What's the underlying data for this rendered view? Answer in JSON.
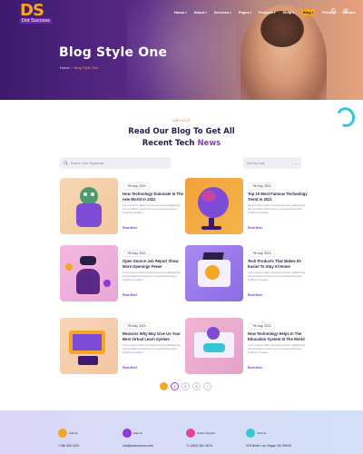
{
  "header": {
    "logo_mark": "DS",
    "logo_sub": "Dot Success",
    "nav": [
      {
        "label": "Home",
        "caret": true
      },
      {
        "label": "About",
        "caret": true
      },
      {
        "label": "Services",
        "caret": true
      },
      {
        "label": "Pages",
        "caret": true
      },
      {
        "label": "Projects",
        "caret": true
      },
      {
        "label": "Shop",
        "caret": true
      },
      {
        "label": "Blog",
        "caret": true,
        "active": true
      },
      {
        "label": "Pricing",
        "caret": false
      },
      {
        "label": "Contact",
        "caret": false
      }
    ],
    "icons": [
      "search-icon",
      "menu-icon"
    ]
  },
  "hero": {
    "title": "Blog Style One",
    "breadcrumb": {
      "home": "Home",
      "sep": "/",
      "current": "Blog Style One"
    }
  },
  "section": {
    "eyebrow": "ARTICLE",
    "heading_line1": "Read Our Blog To Get All",
    "heading_line2_pre": "Recent Tech ",
    "heading_line2_accent": "News"
  },
  "filters": {
    "search_placeholder": "Search Your Keywords",
    "select_value": "Sort by Date"
  },
  "posts": [
    {
      "date": "7th July, 2021",
      "title": "How Technology Dominate In The new World In 2021",
      "excerpt": "Lorem ipsum dolor sit amet consect eadipiscing elit sed diam nonummy et to euismod tempor incidunt ut labore.",
      "more": "Read More"
    },
    {
      "date": "7th July, 2021",
      "title": "Top 10 Most Famous Technology Trend In 2021",
      "excerpt": "Lorem ipsum dolor sit amet consect eadipiscing elit sed diam nonummy et to euismod tempor incidunt ut labore.",
      "more": "Read More"
    },
    {
      "date": "7th July, 2021",
      "title": "Open Source Job Report Show More Openings Fewer",
      "excerpt": "Lorem ipsum dolor sit amet consect eadipiscing elit sed diam nonummy et to euismod tempor incidunt ut labore.",
      "more": "Read More"
    },
    {
      "date": "7th July, 2021",
      "title": "Tech Products That Makes Its Easier To Stay At Home",
      "excerpt": "Lorem ipsum dolor sit amet consect eadipiscing elit sed diam nonummy et to euismod tempor incidunt ut labore.",
      "more": "Read More"
    },
    {
      "date": "7th July, 2021",
      "title": "Reasons Why May Give Us Your Best Virtual Learn System",
      "excerpt": "Lorem ipsum dolor sit amet consect eadipiscing elit sed diam nonummy et to euismod tempor incidunt ut labore.",
      "more": "Read More"
    },
    {
      "date": "7th July, 2021",
      "title": "How Technology Helps In The Education System In The World",
      "excerpt": "Lorem ipsum dolor sit amet consect eadipiscing elit sed diam nonummy et to euismod tempor incidunt ut labore.",
      "more": "Read More"
    }
  ],
  "pagination": {
    "prev": "‹",
    "pages": [
      "1",
      "2",
      "3"
    ],
    "next": "›",
    "current": "1"
  },
  "footer": [
    {
      "label": "Call Us",
      "value": "+786 005 4321",
      "icon": "phone-icon",
      "color": "#f5a623"
    },
    {
      "label": "Mail Us",
      "value": "info@dotsuccess.com",
      "icon": "mail-icon",
      "color": "#8b3ad6"
    },
    {
      "label": "Online Support",
      "value": "+1 (562) 952-3876",
      "icon": "support-icon",
      "color": "#e7458f"
    },
    {
      "label": "Visit Us",
      "value": "225 North Las Vegas, NV 89032",
      "icon": "location-icon",
      "color": "#35c7d6"
    }
  ],
  "colors": {
    "accent": "#f5a623",
    "brand": "#8b3ad6",
    "dark": "#2a1f4a"
  }
}
